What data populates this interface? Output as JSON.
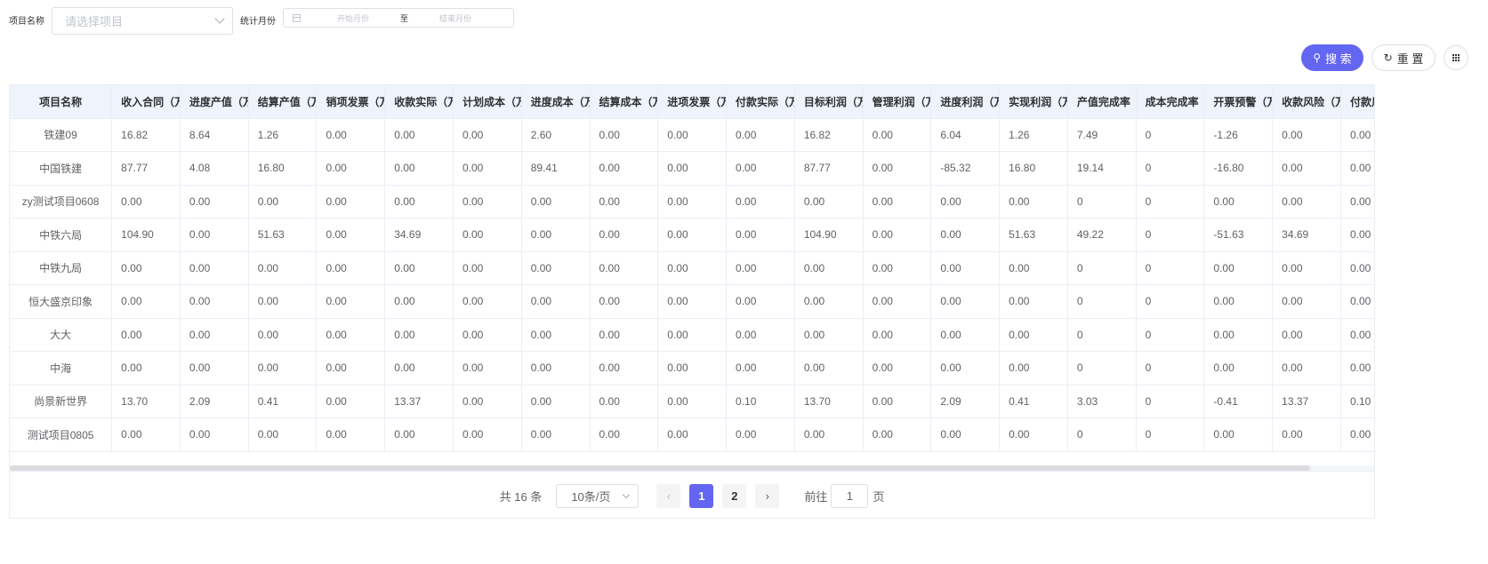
{
  "filters": {
    "project_label": "项目名称",
    "project_placeholder": "请选择项目",
    "month_label": "统计月份",
    "start_placeholder": "开始月份",
    "range_sep": "至",
    "end_placeholder": "结束月份"
  },
  "actions": {
    "search_label": "搜 索",
    "reset_label": "重 置"
  },
  "table": {
    "headers": [
      "项目名称",
      "收入合同（万",
      "进度产值（万",
      "结算产值（万",
      "销项发票（万",
      "收款实际（万",
      "计划成本（万",
      "进度成本（万",
      "结算成本（万",
      "进项发票（万",
      "付款实际（万",
      "目标利润（万",
      "管理利润（万",
      "进度利润（万",
      "实现利润（万",
      "产值完成率（",
      "成本完成率（",
      "开票预警（万",
      "收款风险（万",
      "付款风险（万"
    ],
    "rows": [
      [
        "铁建09",
        "16.82",
        "8.64",
        "1.26",
        "0.00",
        "0.00",
        "0.00",
        "2.60",
        "0.00",
        "0.00",
        "0.00",
        "16.82",
        "0.00",
        "6.04",
        "1.26",
        "7.49",
        "0",
        "-1.26",
        "0.00",
        "0.00"
      ],
      [
        "中国铁建",
        "87.77",
        "4.08",
        "16.80",
        "0.00",
        "0.00",
        "0.00",
        "89.41",
        "0.00",
        "0.00",
        "0.00",
        "87.77",
        "0.00",
        "-85.32",
        "16.80",
        "19.14",
        "0",
        "-16.80",
        "0.00",
        "0.00"
      ],
      [
        "zy测试项目0608",
        "0.00",
        "0.00",
        "0.00",
        "0.00",
        "0.00",
        "0.00",
        "0.00",
        "0.00",
        "0.00",
        "0.00",
        "0.00",
        "0.00",
        "0.00",
        "0.00",
        "0",
        "0",
        "0.00",
        "0.00",
        "0.00"
      ],
      [
        "中铁六局",
        "104.90",
        "0.00",
        "51.63",
        "0.00",
        "34.69",
        "0.00",
        "0.00",
        "0.00",
        "0.00",
        "0.00",
        "104.90",
        "0.00",
        "0.00",
        "51.63",
        "49.22",
        "0",
        "-51.63",
        "34.69",
        "0.00"
      ],
      [
        "中铁九局",
        "0.00",
        "0.00",
        "0.00",
        "0.00",
        "0.00",
        "0.00",
        "0.00",
        "0.00",
        "0.00",
        "0.00",
        "0.00",
        "0.00",
        "0.00",
        "0.00",
        "0",
        "0",
        "0.00",
        "0.00",
        "0.00"
      ],
      [
        "恒大盛京印象",
        "0.00",
        "0.00",
        "0.00",
        "0.00",
        "0.00",
        "0.00",
        "0.00",
        "0.00",
        "0.00",
        "0.00",
        "0.00",
        "0.00",
        "0.00",
        "0.00",
        "0",
        "0",
        "0.00",
        "0.00",
        "0.00"
      ],
      [
        "大大",
        "0.00",
        "0.00",
        "0.00",
        "0.00",
        "0.00",
        "0.00",
        "0.00",
        "0.00",
        "0.00",
        "0.00",
        "0.00",
        "0.00",
        "0.00",
        "0.00",
        "0",
        "0",
        "0.00",
        "0.00",
        "0.00"
      ],
      [
        "中海",
        "0.00",
        "0.00",
        "0.00",
        "0.00",
        "0.00",
        "0.00",
        "0.00",
        "0.00",
        "0.00",
        "0.00",
        "0.00",
        "0.00",
        "0.00",
        "0.00",
        "0",
        "0",
        "0.00",
        "0.00",
        "0.00"
      ],
      [
        "尚景新世界",
        "13.70",
        "2.09",
        "0.41",
        "0.00",
        "13.37",
        "0.00",
        "0.00",
        "0.00",
        "0.00",
        "0.10",
        "13.70",
        "0.00",
        "2.09",
        "0.41",
        "3.03",
        "0",
        "-0.41",
        "13.37",
        "0.10"
      ],
      [
        "测试项目0805",
        "0.00",
        "0.00",
        "0.00",
        "0.00",
        "0.00",
        "0.00",
        "0.00",
        "0.00",
        "0.00",
        "0.00",
        "0.00",
        "0.00",
        "0.00",
        "0.00",
        "0",
        "0",
        "0.00",
        "0.00",
        "0.00"
      ]
    ]
  },
  "pagination": {
    "total_text": "共 16 条",
    "page_size": "10条/页",
    "pages": [
      "1",
      "2"
    ],
    "current_page": "1",
    "goto_prefix": "前往",
    "goto_value": "1",
    "goto_suffix": "页"
  }
}
